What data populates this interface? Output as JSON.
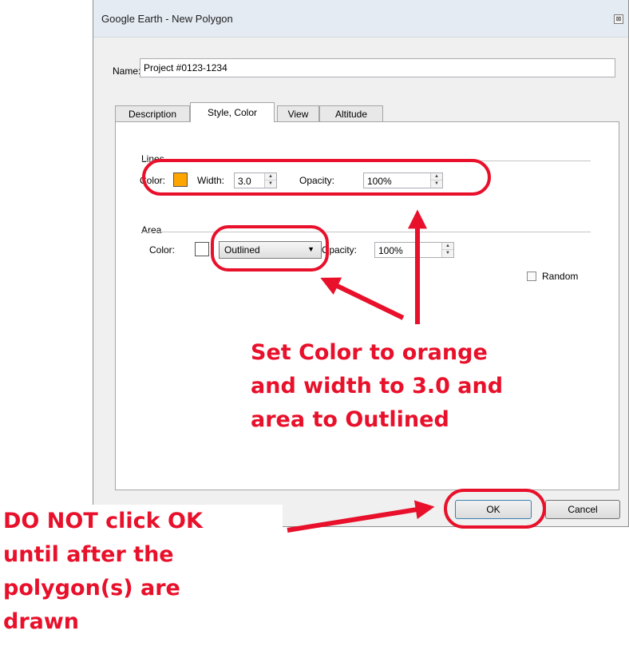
{
  "window": {
    "title": "Google Earth - New Polygon",
    "close_glyph": "⊠"
  },
  "name_field": {
    "label": "Name:",
    "value": "Project #0123-1234"
  },
  "tabs": [
    {
      "label": "Description",
      "active": false
    },
    {
      "label": "Style, Color",
      "active": true
    },
    {
      "label": "View",
      "active": false
    },
    {
      "label": "Altitude",
      "active": false
    }
  ],
  "lines": {
    "group_label": "Lines",
    "color_label": "Color:",
    "color": "#ffa500",
    "width_label": "Width:",
    "width_value": "3.0",
    "opacity_label": "Opacity:",
    "opacity_value": "100%"
  },
  "area": {
    "group_label": "Area",
    "color_label": "Color:",
    "color": "#ffffff",
    "fill_selected": "Outlined",
    "opacity_label": "Opacity:",
    "opacity_value": "100%",
    "random_label": "Random",
    "random_checked": false
  },
  "buttons": {
    "ok": "OK",
    "cancel": "Cancel"
  },
  "annotations": {
    "instruction": [
      "Set Color to orange",
      "and width to 3.0 and",
      "area to Outlined"
    ],
    "warning": [
      "DO NOT click OK",
      "until after the",
      "polygon(s) are",
      "drawn"
    ],
    "highlight_color": "#e8102a"
  }
}
